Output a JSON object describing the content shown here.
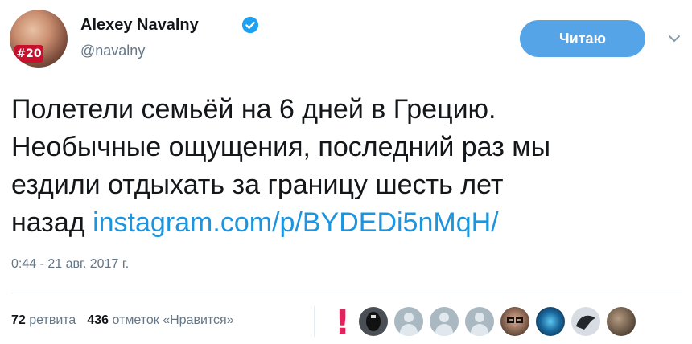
{
  "tweet": {
    "author_name": "Alexey Navalny",
    "author_handle": "@navalny",
    "avatar_badge": "#20",
    "follow_label": "Читаю",
    "text_line1": "Полетели семьёй на 6 дней в Грецию.",
    "text_line2": "Необычные ощущения, последний раз мы",
    "text_line3": "ездили отдыхать за границу шесть лет",
    "text_line4_prefix": "назад ",
    "link": "instagram.com/p/BYDEDi5nMqH/",
    "timestamp": "0:44 - 21 авг. 2017 г."
  },
  "stats": {
    "retweets_count": "72",
    "retweets_label": "ретвита",
    "likes_count": "436",
    "likes_label": "отметок «Нравится»"
  },
  "likers": [
    "exclamation-mark",
    "dark-mask",
    "default",
    "default",
    "default",
    "glasses-face",
    "blue-figure",
    "dark-bird",
    "group-photo"
  ],
  "colors": {
    "accent": "#1b95e0",
    "follow_button_bg": "#56a4e8",
    "verified": "#1da1f2",
    "secondary_text": "#657786",
    "like_red": "#e0245e"
  }
}
